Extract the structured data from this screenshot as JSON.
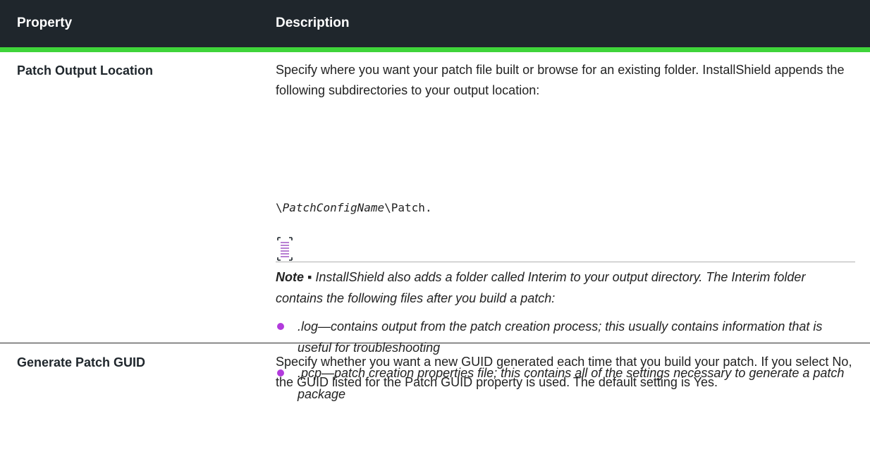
{
  "table": {
    "headers": {
      "property": "Property",
      "description": "Description"
    },
    "rows": [
      {
        "property": "Patch Output Location",
        "description": "Specify where you want your patch file built or browse for an existing folder. InstallShield appends the following subdirectories to your output location:",
        "path_prefix": "\\",
        "path_italic": "PatchConfigName",
        "path_suffix": "\\Patch.",
        "note_label": "Note",
        "note_separator": "▪",
        "note_text": "InstallShield also adds a folder called Interim to your output directory. The Interim folder contains the following files after you build a patch:",
        "bullets": [
          ".log—contains output from the patch creation process; this usually contains information that is useful for troubleshooting",
          ".pcp—patch creation properties file; this contains all of the settings necessary to generate a patch package"
        ]
      },
      {
        "property": "Generate Patch GUID",
        "description": "Specify whether you want a new GUID generated each time that you build your patch. If you select No, the GUID listed for the Patch GUID property is used. The default setting is Yes."
      }
    ]
  },
  "colors": {
    "header_bg": "#1f262c",
    "header_accent": "#3fd43a",
    "bullet": "#b23bdc",
    "note_icon": "#8a2bb5"
  },
  "icons": {
    "note": "note-icon"
  }
}
